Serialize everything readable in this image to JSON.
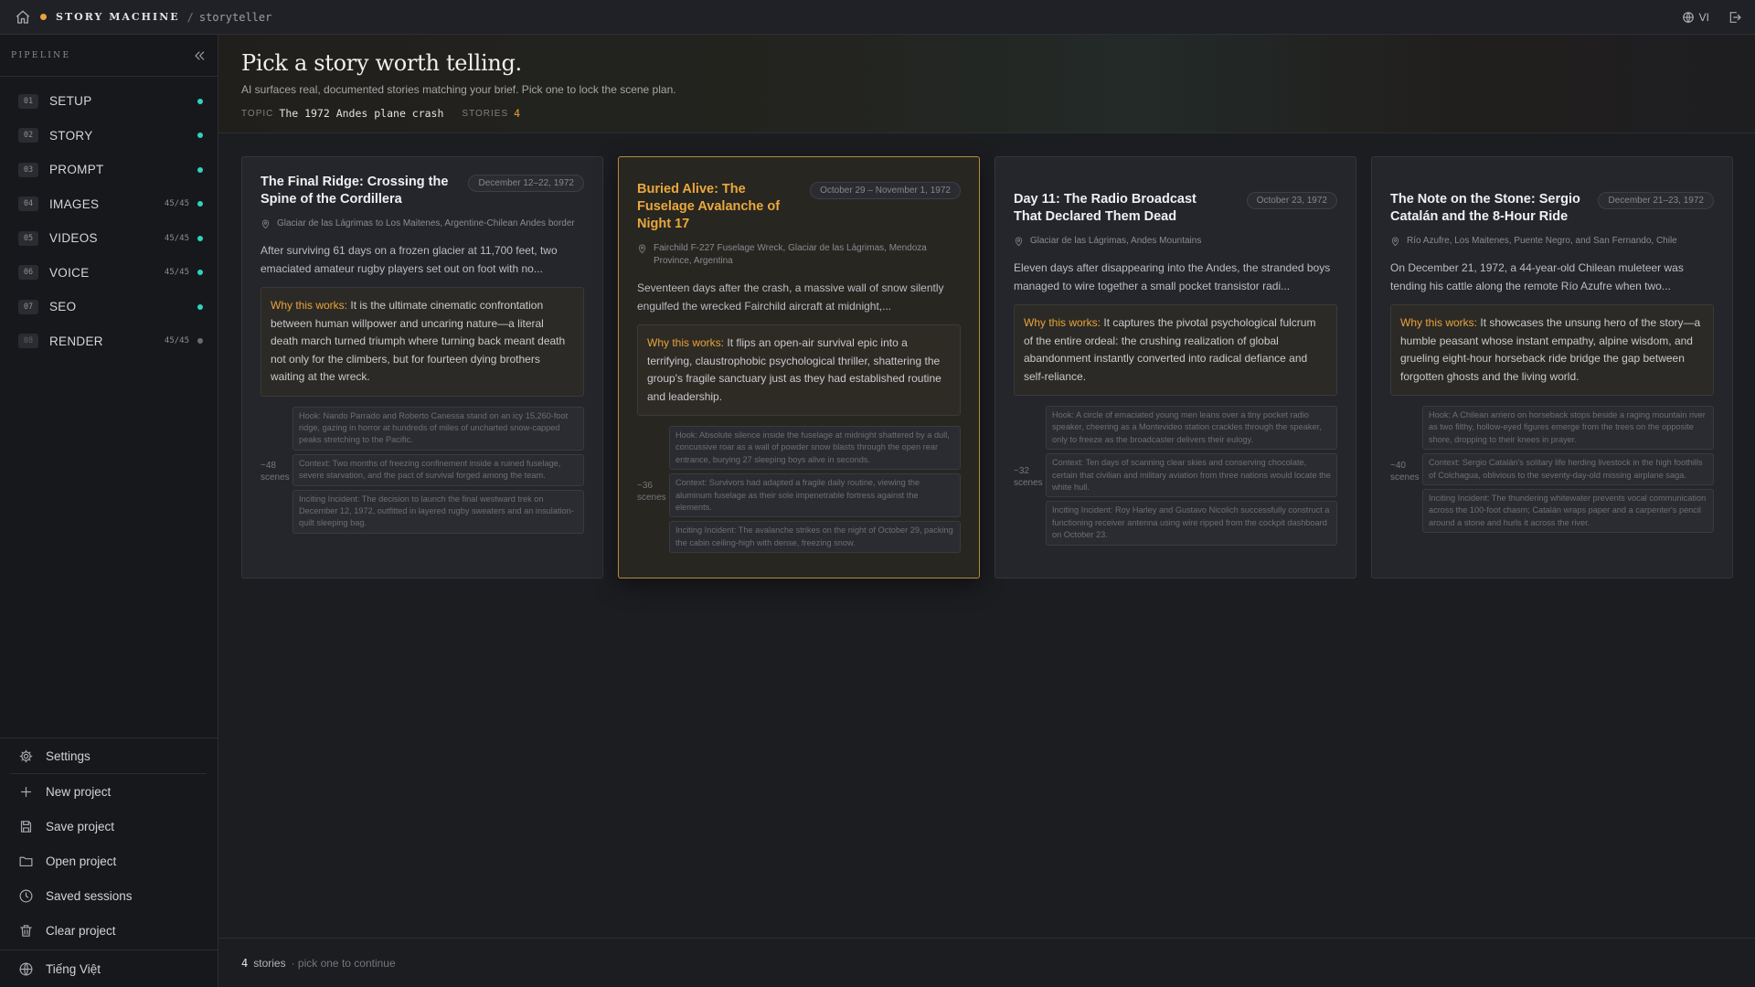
{
  "topbar": {
    "brand": "STORY MACHINE",
    "separator": "/",
    "crumb": "storyteller",
    "lang": "VI",
    "accent": "#e8a33a",
    "icons": [
      "home-icon",
      "globe-icon",
      "logout-icon"
    ]
  },
  "sidebar": {
    "title": "PIPELINE",
    "steps": [
      {
        "num": "01",
        "label": "SETUP",
        "count": "",
        "status": "done"
      },
      {
        "num": "02",
        "label": "STORY",
        "count": "",
        "status": "done"
      },
      {
        "num": "03",
        "label": "PROMPT",
        "count": "",
        "status": "done"
      },
      {
        "num": "04",
        "label": "IMAGES",
        "count": "45/45",
        "status": "done"
      },
      {
        "num": "05",
        "label": "VIDEOS",
        "count": "45/45",
        "status": "done"
      },
      {
        "num": "06",
        "label": "VOICE",
        "count": "45/45",
        "status": "done"
      },
      {
        "num": "07",
        "label": "SEO",
        "count": "",
        "status": "done"
      },
      {
        "num": "08",
        "label": "RENDER",
        "count": "45/45",
        "status": "pending"
      }
    ],
    "settings": "Settings",
    "actions": {
      "new": "New project",
      "save": "Save project",
      "open": "Open project",
      "sessions": "Saved sessions",
      "clear": "Clear project"
    },
    "language": "Tiếng Việt"
  },
  "hero": {
    "title": "Pick a story worth telling.",
    "subtitle": "AI surfaces real, documented stories matching your brief. Pick one to lock the scene plan.",
    "topic_label": "TOPIC",
    "topic": "The 1972 Andes plane crash",
    "stories_label": "STORIES",
    "stories": "4"
  },
  "why_label": "Why this works:",
  "scenes_label": "scenes",
  "cards": [
    {
      "title": "The Final Ridge: Crossing the Spine of the Cordillera",
      "date": "December 12–22, 1972",
      "location": "Glaciar de las Lágrimas to Los Maitenes, Argentine-Chilean Andes border",
      "desc": "After surviving 61 days on a frozen glacier at 11,700 feet, two emaciated amateur rugby players set out on foot with no...",
      "why": "It is the ultimate cinematic confrontation between human willpower and uncaring nature—a literal death march turned triumph where turning back meant death not only for the climbers, but for fourteen dying brothers waiting at the wreck.",
      "scenes": "~48",
      "beats": [
        "Hook: Nando Parrado and Roberto Canessa stand on an icy 15,260-foot ridge, gazing in horror at hundreds of miles of uncharted snow-capped peaks stretching to the Pacific.",
        "Context: Two months of freezing confinement inside a ruined fuselage, severe starvation, and the pact of survival forged among the team.",
        "Inciting Incident: The decision to launch the final westward trek on December 12, 1972, outfitted in layered rugby sweaters and an insulation-quilt sleeping bag."
      ]
    },
    {
      "title": "Buried Alive: The Fuselage Avalanche of Night 17",
      "date": "October 29 – November 1, 1972",
      "location": "Fairchild F-227 Fuselage Wreck, Glaciar de las Lágrimas, Mendoza Province, Argentina",
      "desc": "Seventeen days after the crash, a massive wall of snow silently engulfed the wrecked Fairchild aircraft at midnight,...",
      "why": "It flips an open-air survival epic into a terrifying, claustrophobic psychological thriller, shattering the group's fragile sanctuary just as they had established routine and leadership.",
      "scenes": "~36",
      "beats": [
        "Hook: Absolute silence inside the fuselage at midnight shattered by a dull, concussive roar as a wall of powder snow blasts through the open rear entrance, burying 27 sleeping boys alive in seconds.",
        "Context: Survivors had adapted a fragile daily routine, viewing the aluminum fuselage as their sole impenetrable fortress against the elements.",
        "Inciting Incident: The avalanche strikes on the night of October 29, packing the cabin ceiling-high with dense, freezing snow."
      ]
    },
    {
      "title": "Day 11: The Radio Broadcast That Declared Them Dead",
      "date": "October 23, 1972",
      "location": "Glaciar de las Lágrimas, Andes Mountains",
      "desc": "Eleven days after disappearing into the Andes, the stranded boys managed to wire together a small pocket transistor radi...",
      "why": "It captures the pivotal psychological fulcrum of the entire ordeal: the crushing realization of global abandonment instantly converted into radical defiance and self-reliance.",
      "scenes": "~32",
      "beats": [
        "Hook: A circle of emaciated young men leans over a tiny pocket radio speaker, cheering as a Montevideo station crackles through the speaker, only to freeze as the broadcaster delivers their eulogy.",
        "Context: Ten days of scanning clear skies and conserving chocolate, certain that civilian and military aviation from three nations would locate the white hull.",
        "Inciting Incident: Roy Harley and Gustavo Nicolich successfully construct a functioning receiver antenna using wire ripped from the cockpit dashboard on October 23."
      ]
    },
    {
      "title": "The Note on the Stone: Sergio Catalán and the 8-Hour Ride",
      "date": "December 21–23, 1972",
      "location": "Río Azufre, Los Maitenes, Puente Negro, and San Fernando, Chile",
      "desc": "On December 21, 1972, a 44-year-old Chilean muleteer was tending his cattle along the remote Río Azufre when two...",
      "why": "It showcases the unsung hero of the story—a humble peasant whose instant empathy, alpine wisdom, and grueling eight-hour horseback ride bridge the gap between forgotten ghosts and the living world.",
      "scenes": "~40",
      "beats": [
        "Hook: A Chilean arriero on horseback stops beside a raging mountain river as two filthy, hollow-eyed figures emerge from the trees on the opposite shore, dropping to their knees in prayer.",
        "Context: Sergio Catalán's solitary life herding livestock in the high foothills of Colchagua, oblivious to the seventy-day-old missing airplane saga.",
        "Inciting Incident: The thundering whitewater prevents vocal communication across the 100-foot chasm; Catalán wraps paper and a carpenter's pencil around a stone and hurls it across the river."
      ]
    }
  ],
  "footer": {
    "count": "4",
    "stories": "stories",
    "hint": "· pick one to continue"
  }
}
